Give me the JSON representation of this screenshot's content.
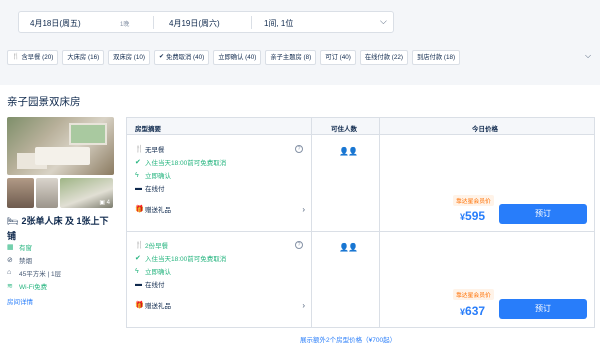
{
  "search": {
    "checkin": "4月18日(周五)",
    "nights": "1晚",
    "checkout": "4月19日(周六)",
    "guests": "1间, 1位"
  },
  "filters": [
    {
      "icon": "breakfast-icon",
      "glyph": "🍴",
      "label": "含早餐 (20)"
    },
    {
      "icon": "",
      "glyph": "",
      "label": "大床房 (16)"
    },
    {
      "icon": "",
      "glyph": "",
      "label": "双床房 (10)"
    },
    {
      "icon": "check-circle-icon",
      "glyph": "✔",
      "label": "免费取消 (40)"
    },
    {
      "icon": "",
      "glyph": "",
      "label": "立即确认 (40)"
    },
    {
      "icon": "",
      "glyph": "",
      "label": "亲子主题房 (8)"
    },
    {
      "icon": "",
      "glyph": "",
      "label": "可订 (40)"
    },
    {
      "icon": "",
      "glyph": "",
      "label": "在线付款 (22)"
    },
    {
      "icon": "",
      "glyph": "",
      "label": "到店付款 (18)"
    }
  ],
  "room": {
    "title": "亲子园景双床房",
    "photo_count": "4",
    "bed": "2张单人床 及 1张上下铺",
    "facts": [
      {
        "icon": "window-icon",
        "glyph": "▦",
        "label": "有窗",
        "style": "green2"
      },
      {
        "icon": "no-smoking-icon",
        "glyph": "⊘",
        "label": "禁烟",
        "style": ""
      },
      {
        "icon": "area-icon",
        "glyph": "⌂",
        "label": "45平方米 | 1层",
        "style": ""
      },
      {
        "icon": "wifi-icon",
        "glyph": "≋",
        "label": "Wi-Fi免费",
        "style": "green2"
      }
    ],
    "details_link": "房间详情"
  },
  "table": {
    "col_summary": "房型摘要",
    "col_occupancy": "可住人数",
    "col_price": "今日价格"
  },
  "rates": [
    {
      "meal": "无早餐",
      "cancel": "入住当天18:00前可免费取消",
      "confirm": "立即确认",
      "payment": "在线付",
      "gift": "赠送礼品",
      "badge": "靠达星会员价",
      "currency": "¥",
      "price": "595",
      "book": "预订"
    },
    {
      "meal": "2份早餐",
      "cancel": "入住当天18:00前可免费取消",
      "confirm": "立即确认",
      "payment": "在线付",
      "gift": "赠送礼品",
      "badge": "靠达星会员价",
      "currency": "¥",
      "price": "637",
      "book": "预订"
    }
  ],
  "more_types": "展示额外2个房型价格（¥700起）",
  "colors": {
    "accent": "#287dfa",
    "green": "#24b47e",
    "orange": "#ff6f00"
  }
}
